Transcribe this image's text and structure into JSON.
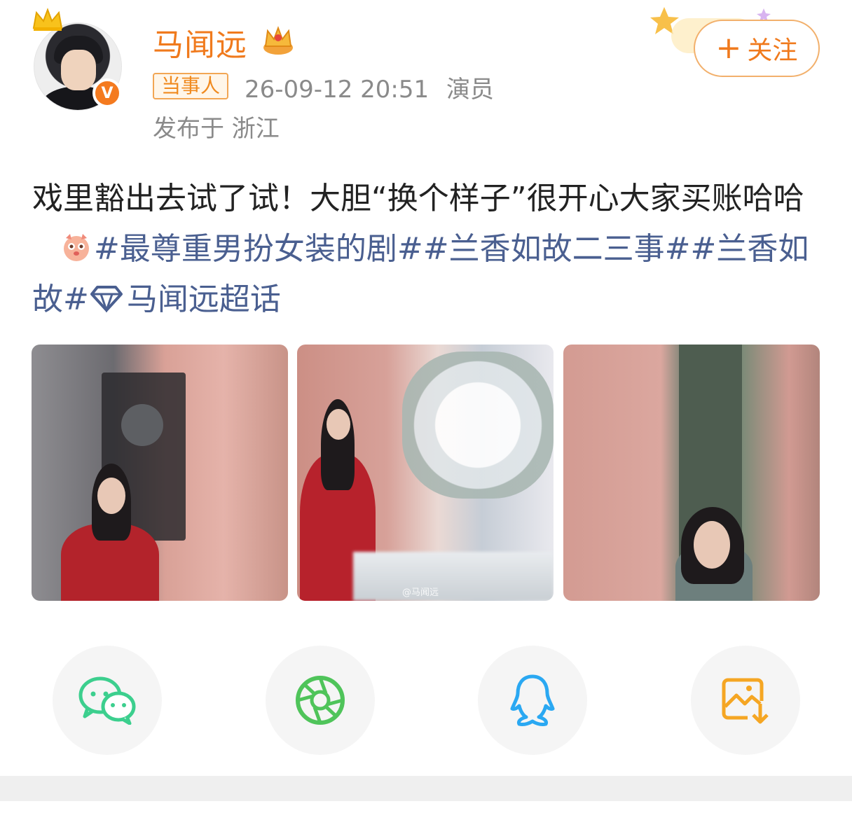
{
  "author": {
    "name": "马闻远",
    "avatar_icon": "user-avatar",
    "crown_icon": "crown-icon",
    "verified_icon": "verified-v-icon",
    "vip_icon": "vip-crown-icon"
  },
  "meta": {
    "badge": "当事人",
    "timestamp": "26-09-12 20:51",
    "occupation": "演员",
    "location": "发布于 浙江"
  },
  "follow": {
    "plus": "+",
    "label": "关注"
  },
  "post": {
    "text": "戏里豁出去试了试！大胆“换个样子”很开心大家买账哈哈",
    "hashtag1": "#最尊重男扮女装的剧#",
    "hashtag2": "#兰香如故二三事#",
    "hashtag3": "#兰香如故#",
    "supertopic": "马闻远超话",
    "emoji_icon": "cute-face-emoji-icon",
    "supertopic_icon": "diamond-icon"
  },
  "images": {
    "watermark": "@马闻远",
    "count": 3
  },
  "share": {
    "wechat_icon": "wechat-icon",
    "moments_icon": "moments-icon",
    "qq_icon": "qq-icon",
    "save_icon": "save-image-icon"
  },
  "colors": {
    "accent": "#f07a1d",
    "hashtag": "#4a5f90",
    "meta_gray": "#8a8a8a",
    "wechat_green": "#3ccf8e",
    "moments_green": "#4fc45a",
    "qq_blue": "#2aa8f2",
    "save_orange": "#f5a623"
  }
}
